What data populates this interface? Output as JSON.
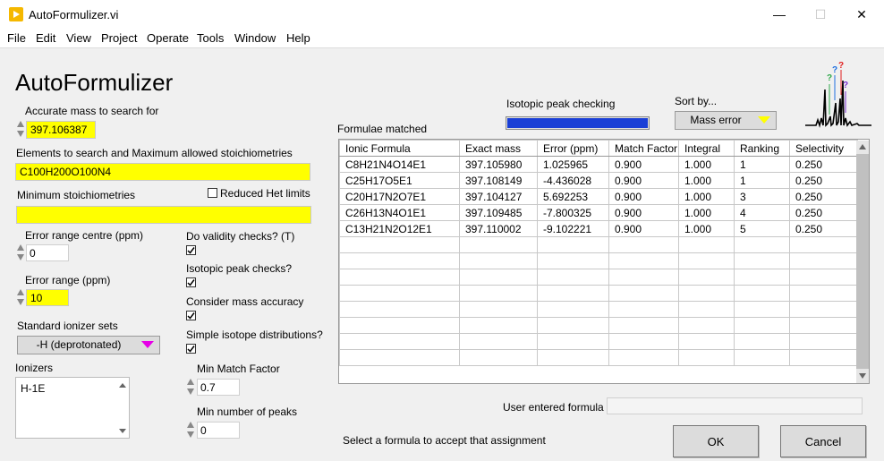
{
  "window": {
    "title": "AutoFormulizer.vi",
    "controls": {
      "minimize": "—",
      "maximize": "☐",
      "close": "✕"
    }
  },
  "menu": [
    "File",
    "Edit",
    "View",
    "Project",
    "Operate",
    "Tools",
    "Window",
    "Help"
  ],
  "app_title": "AutoFormulizer",
  "accurate_mass": {
    "label": "Accurate mass to search for",
    "value": "397.106387"
  },
  "elements": {
    "label": "Elements to search and Maximum allowed stoichiometries",
    "value": "C100H200O100N4"
  },
  "min_stoich": {
    "label": "Minimum stoichiometries",
    "value": ""
  },
  "reduced_het": {
    "label": "Reduced Het limits",
    "checked": false
  },
  "error_centre": {
    "label": "Error range centre (ppm)",
    "value": "0"
  },
  "error_range": {
    "label": "Error range (ppm)",
    "value": "10"
  },
  "ionizer_sets": {
    "label": "Standard ionizer sets",
    "value": "-H (deprotonated)"
  },
  "ionizers": {
    "label": "Ionizers",
    "value": "H-1E"
  },
  "checks": [
    {
      "label": "Do validity checks? (T)",
      "checked": true
    },
    {
      "label": "Isotopic peak checks?",
      "checked": true
    },
    {
      "label": "Consider mass accuracy",
      "checked": true
    },
    {
      "label": "Simple isotope distributions?",
      "checked": true
    }
  ],
  "min_match_factor": {
    "label": "Min Match Factor",
    "value": "0.7"
  },
  "min_peaks": {
    "label": "Min number of peaks",
    "value": "0"
  },
  "isotopic_progress": {
    "label": "Isotopic peak checking",
    "value": 1.0
  },
  "sort_by": {
    "label": "Sort by...",
    "value": "Mass error"
  },
  "formulae": {
    "label": "Formulae matched",
    "columns": [
      "Ionic Formula",
      "Exact mass",
      "Error (ppm)",
      "Match Factor",
      "Integral",
      "Ranking",
      "Selectivity"
    ],
    "rows": [
      [
        "C8H21N4O14E1",
        "397.105980",
        "1.025965",
        "0.900",
        "1.000",
        "1",
        "0.250"
      ],
      [
        "C25H17O5E1",
        "397.108149",
        "-4.436028",
        "0.900",
        "1.000",
        "1",
        "0.250"
      ],
      [
        "C20H17N2O7E1",
        "397.104127",
        "5.692253",
        "0.900",
        "1.000",
        "3",
        "0.250"
      ],
      [
        "C26H13N4O1E1",
        "397.109485",
        "-7.800325",
        "0.900",
        "1.000",
        "4",
        "0.250"
      ],
      [
        "C13H21N2O12E1",
        "397.110002",
        "-9.102221",
        "0.900",
        "1.000",
        "5",
        "0.250"
      ]
    ],
    "empty_rows": 8
  },
  "user_formula": {
    "label": "User entered formula",
    "value": ""
  },
  "hint": "Select a formula to accept that assignment",
  "ok_label": "OK",
  "cancel_label": "Cancel",
  "colors": {
    "highlight": "#ffff00",
    "progress": "#1a3fd6",
    "ring_arrow_pink": "#e600e6",
    "ring_arrow_yellow": "#ffff00"
  },
  "logo": {
    "marks": [
      "?",
      "?",
      "?",
      "?"
    ]
  }
}
